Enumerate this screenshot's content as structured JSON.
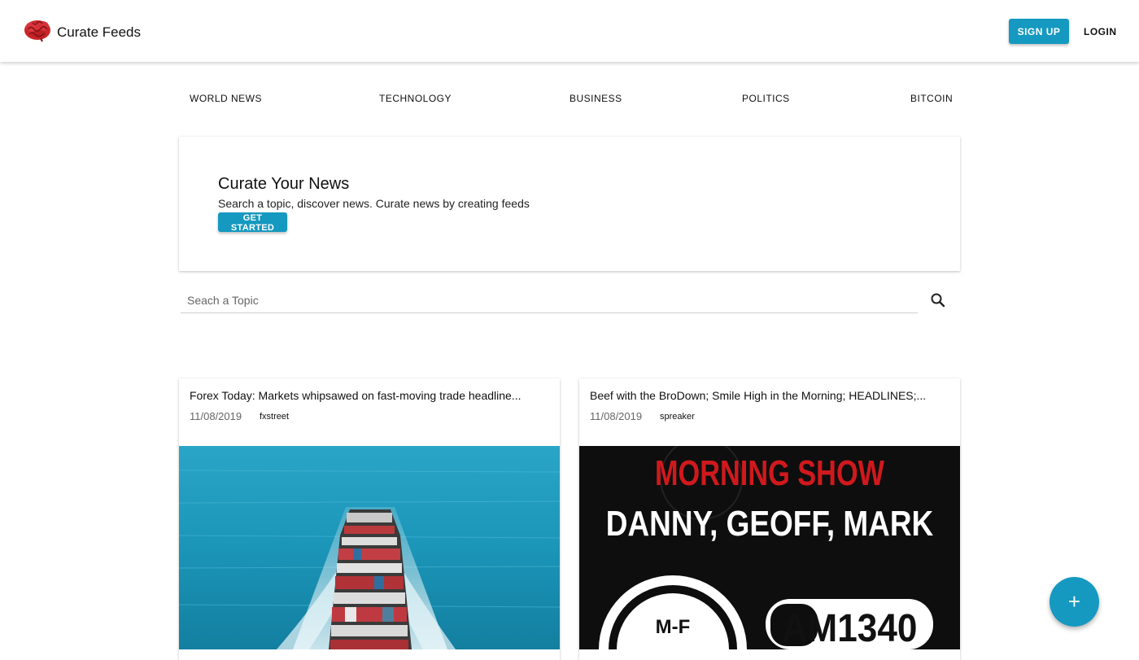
{
  "header": {
    "brand": "Curate Feeds",
    "logo_icon": "brain-icon",
    "signup_label": "SIGN UP",
    "login_label": "LOGIN"
  },
  "nav": {
    "items": [
      "WORLD NEWS",
      "TECHNOLOGY",
      "BUSINESS",
      "POLITICS",
      "BITCOIN"
    ]
  },
  "hero": {
    "title": "Curate Your News",
    "subtitle": "Search a topic, discover news. Curate news by creating feeds",
    "cta_label": "GET STARTED"
  },
  "search": {
    "placeholder": "Seach a Topic",
    "icon": "search-icon"
  },
  "cards": [
    {
      "title": "Forex Today: Markets whipsawed on fast-moving trade headline...",
      "date": "11/08/2019",
      "source": "fxstreet",
      "image": "cargo-ship-photo"
    },
    {
      "title": "Beef with the BroDown; Smile High in the Morning; HEADLINES;...",
      "date": "11/08/2019",
      "source": "spreaker",
      "image": "radio-show-banner",
      "image_text": {
        "line1": "MORNING SHOW",
        "line2": "DANNY, GEOFF, MARK",
        "badge_left": "M-F",
        "badge_right": "AM1340"
      }
    }
  ],
  "fab": {
    "label": "+",
    "icon": "add-icon"
  },
  "colors": {
    "accent": "#1599c0",
    "morning_show_red": "#d0191d"
  }
}
